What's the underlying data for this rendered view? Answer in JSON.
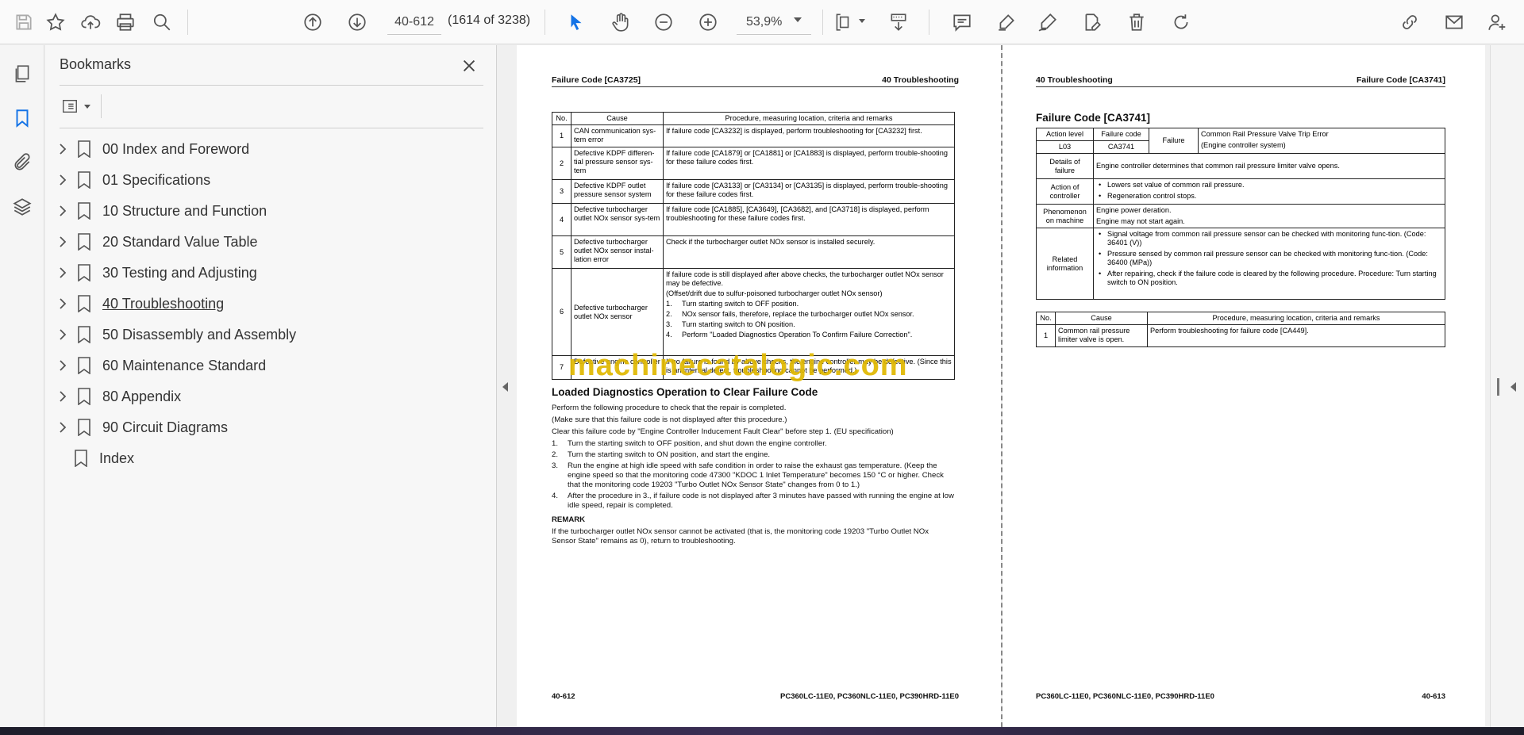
{
  "toolbar": {
    "page_value": "40-612",
    "page_count": "(1614 of 3238)",
    "zoom": "53,9%"
  },
  "bookmarks": {
    "title": "Bookmarks",
    "items": [
      {
        "label": "00 Index and Foreword"
      },
      {
        "label": "01 Specifications"
      },
      {
        "label": "10 Structure and Function"
      },
      {
        "label": "20 Standard Value Table"
      },
      {
        "label": "30 Testing and Adjusting"
      },
      {
        "label": "40 Troubleshooting"
      },
      {
        "label": "50 Disassembly and Assembly"
      },
      {
        "label": "60 Maintenance Standard"
      },
      {
        "label": "80 Appendix"
      },
      {
        "label": "90 Circuit Diagrams"
      },
      {
        "label": "Index"
      }
    ]
  },
  "left_page": {
    "header_left": "Failure Code [CA3725]",
    "header_right": "40 Troubleshooting",
    "table_headers": {
      "no": "No.",
      "cause": "Cause",
      "procedure": "Procedure, measuring location, criteria and remarks"
    },
    "rows": [
      {
        "no": "1",
        "cause": "CAN communication sys-tem error",
        "procedure": "If failure code [CA3232] is displayed, perform troubleshooting for [CA3232] first."
      },
      {
        "no": "2",
        "cause": "Defective KDPF differen-tial pressure sensor sys-tem",
        "procedure": "If failure code [CA1879] or [CA1881] or [CA1883] is displayed, perform trouble-shooting for these failure codes first."
      },
      {
        "no": "3",
        "cause": "Defective KDPF outlet pressure sensor system",
        "procedure": "If failure code [CA3133] or [CA3134] or [CA3135] is displayed, perform trouble-shooting for these failure codes first."
      },
      {
        "no": "4",
        "cause": "Defective turbocharger outlet NOx sensor sys-tem",
        "procedure": "If failure code [CA1885], [CA3649], [CA3682], and [CA3718] is displayed, perform troubleshooting for these failure codes first."
      },
      {
        "no": "5",
        "cause": "Defective turbocharger outlet NOx sensor instal-lation error",
        "procedure": "Check if the turbocharger outlet NOx sensor is installed securely."
      },
      {
        "no": "6",
        "cause": "Defective turbocharger outlet NOx sensor",
        "procedure_intro": "If failure code is still displayed after above checks, the turbocharger outlet NOx sensor may be defective.",
        "procedure_note": "(Offset/drift due to sulfur-poisoned turbocharger outlet NOx sensor)",
        "steps": [
          {
            "n": "1.",
            "t": "Turn starting switch to OFF position."
          },
          {
            "n": "2.",
            "t": "NOx sensor fails, therefore, replace the turbocharger outlet NOx sensor."
          },
          {
            "n": "3.",
            "t": "Turn starting switch to ON position."
          },
          {
            "n": "4.",
            "t": "Perform \"Loaded Diagnostics Operation To Confirm Failure Correction\"."
          }
        ]
      },
      {
        "no": "7",
        "cause": "Defective engine controller",
        "procedure": "If no failure is found by above checks, the engine controller may be defective. (Since this is an internal defect, troubleshooting cannot be performed.)"
      }
    ],
    "section_title": "Loaded Diagnostics Operation to Clear Failure Code",
    "paragraphs": [
      "Perform the following procedure to check that the repair is completed.",
      "(Make sure that this failure code is not displayed after this procedure.)",
      "Clear this failure code by \"Engine Controller Inducement Fault Clear\" before step 1. (EU specification)"
    ],
    "steps": [
      {
        "n": "1.",
        "t": "Turn the starting switch to OFF position, and shut down the engine controller."
      },
      {
        "n": "2.",
        "t": "Turn the starting switch to ON position, and start the engine."
      },
      {
        "n": "3.",
        "t": "Run the engine at high idle speed with safe condition in order to raise the exhaust gas temperature. (Keep the engine speed so that the monitoring code 47300 \"KDOC 1 Inlet Temperature\" becomes 150 °C or higher. Check that the monitoring code 19203 \"Turbo Outlet NOx Sensor State\" changes from 0 to 1.)"
      },
      {
        "n": "4.",
        "t": "After the procedure in 3., if failure code is not displayed after 3 minutes have passed with running the engine at low idle speed, repair is completed."
      }
    ],
    "remark_title": "REMARK",
    "remark_text": "If the turbocharger outlet NOx sensor cannot be activated (that is, the monitoring code 19203 \"Turbo Outlet NOx Sensor State\" remains as 0), return to troubleshooting.",
    "footer_left": "40-612",
    "footer_right": "PC360LC-11E0, PC360NLC-11E0, PC390HRD-11E0"
  },
  "right_page": {
    "header_left": "40 Troubleshooting",
    "header_right": "Failure Code [CA3741]",
    "title": "Failure Code [CA3741]",
    "info": {
      "action_level_h": "Action level",
      "failure_code_h": "Failure code",
      "action_level": "L03",
      "failure_code": "CA3741",
      "failure_h": "Failure",
      "failure_name": "Common Rail Pressure Valve Trip Error",
      "failure_sub": "(Engine controller system)",
      "details_h": "Details of failure",
      "details": "Engine controller determines that common rail pressure limiter valve opens.",
      "action_h": "Action of controller",
      "actions": [
        "Lowers set value of common rail pressure.",
        "Regeneration control stops."
      ],
      "phenomenon_h": "Phenomenon on machine",
      "phenomenon": [
        "Engine power deration.",
        "Engine may not start again."
      ],
      "related_h": "Related information",
      "related": [
        "Signal voltage from common rail pressure sensor can be checked with monitoring func-tion. (Code: 36401 (V))",
        "Pressure sensed by common rail pressure sensor can be checked with monitoring func-tion. (Code: 36400 (MPa))",
        "After repairing, check if the failure code is cleared by the following procedure. Procedure: Turn starting switch to ON position."
      ]
    },
    "table_headers": {
      "no": "No.",
      "cause": "Cause",
      "procedure": "Procedure, measuring location, criteria and remarks"
    },
    "rows": [
      {
        "no": "1",
        "cause": "Common rail pressure limiter valve is open.",
        "procedure": "Perform troubleshooting for failure code [CA449]."
      }
    ],
    "footer_left": "PC360LC-11E0, PC360NLC-11E0, PC390HRD-11E0",
    "footer_right": "40-613"
  },
  "watermark": "machinecatalogic.com"
}
